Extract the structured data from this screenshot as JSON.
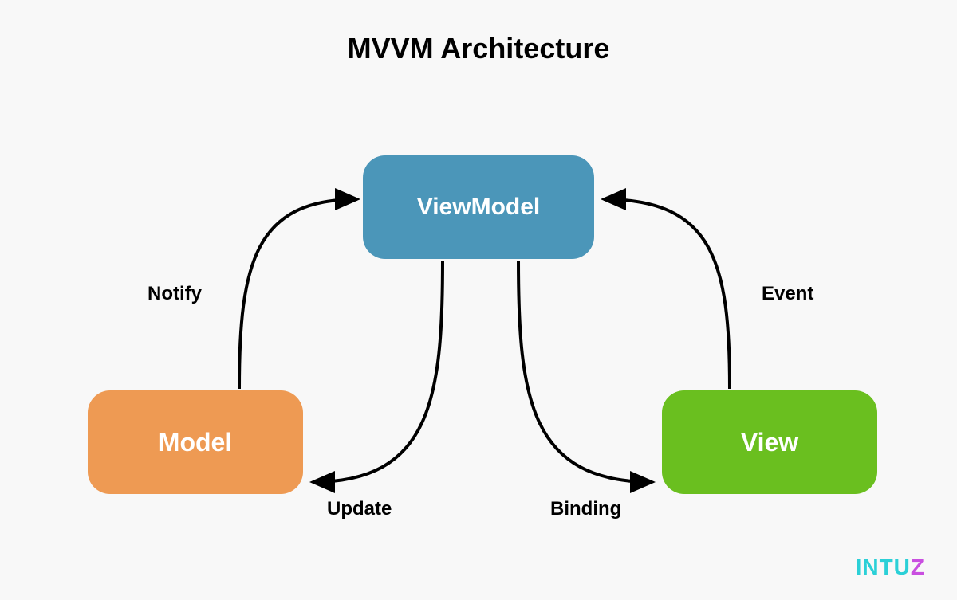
{
  "title": "MVVM Architecture",
  "nodes": {
    "viewmodel": {
      "label": "ViewModel",
      "color": "#4b96b9"
    },
    "model": {
      "label": "Model",
      "color": "#ee9a53"
    },
    "view": {
      "label": "View",
      "color": "#6abf1f"
    }
  },
  "edges": {
    "notify": {
      "label": "Notify",
      "from": "model",
      "to": "viewmodel"
    },
    "update": {
      "label": "Update",
      "from": "viewmodel",
      "to": "model"
    },
    "binding": {
      "label": "Binding",
      "from": "viewmodel",
      "to": "view"
    },
    "event": {
      "label": "Event",
      "from": "view",
      "to": "viewmodel"
    }
  },
  "brand": {
    "part1": "INTU",
    "part2": "Z"
  }
}
